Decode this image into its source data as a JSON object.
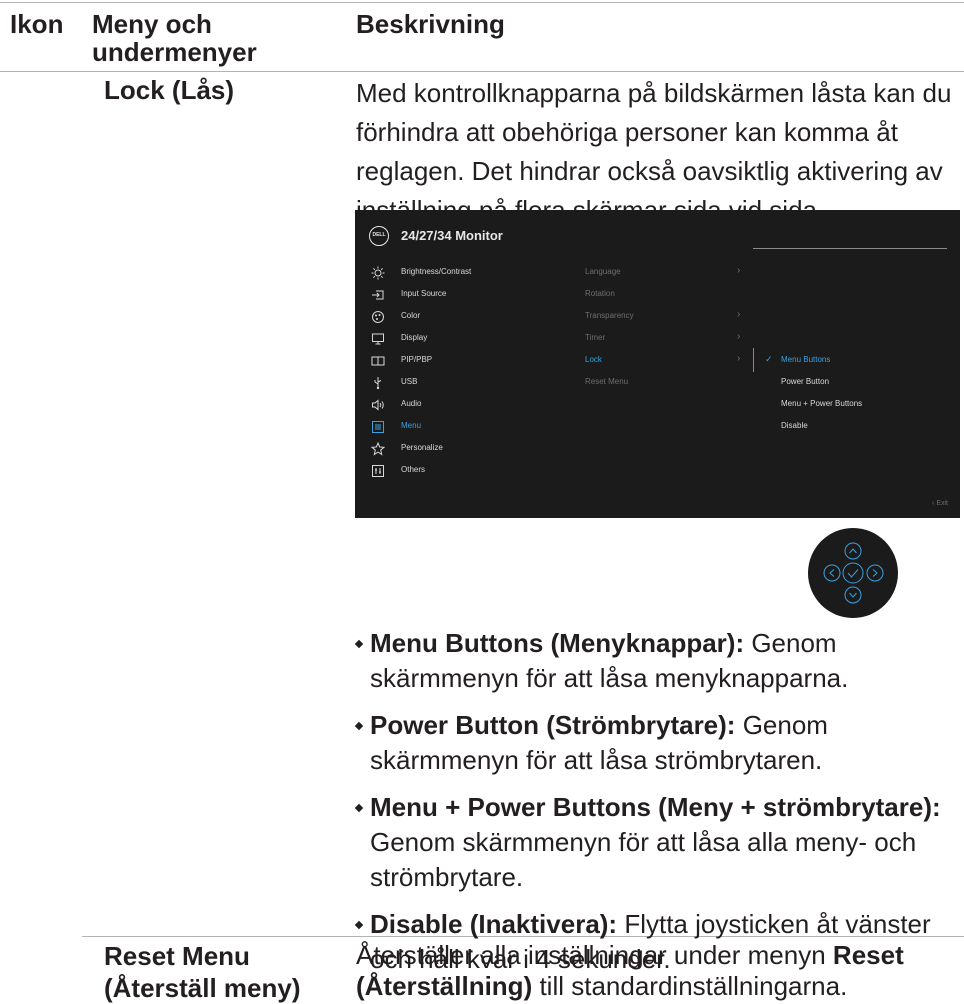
{
  "header": {
    "icon": "Ikon",
    "menu": "Meny och undermenyer",
    "description": "Beskrivning"
  },
  "lock": {
    "name": "Lock (Lås)",
    "intro": "Med kontrollknapparna på bildskärmen låsta kan du förhindra att obehöriga personer kan komma åt reglagen. Det hindrar också oavsiktlig aktivering av inställning på flera skärmar sida vid sida."
  },
  "osd": {
    "title": "24/27/34 Monitor",
    "logo": "DELL",
    "main_menu": [
      "Brightness/Contrast",
      "Input Source",
      "Color",
      "Display",
      "PIP/PBP",
      "USB",
      "Audio",
      "Menu",
      "Personalize",
      "Others"
    ],
    "main_icons": [
      "brightness-icon",
      "input-source-icon",
      "color-icon",
      "display-icon",
      "pip-pbp-icon",
      "usb-icon",
      "audio-icon",
      "menu-icon",
      "personalize-icon",
      "others-icon"
    ],
    "selected_main": "Menu",
    "sub_menu": [
      "Language",
      "Rotation",
      "Transparency",
      "Timer",
      "Lock",
      "Reset Menu"
    ],
    "selected_sub": "Lock",
    "lock_options": [
      "Menu Buttons",
      "Power Button",
      "Menu + Power Buttons",
      "Disable"
    ],
    "selected_option": "Menu Buttons",
    "exit_label": "Exit",
    "accent_color": "#3aa0e0"
  },
  "bullets": [
    {
      "bold": "Menu Buttons (Menyknappar):",
      "text": " Genom skärmmenyn för att låsa menyknapparna."
    },
    {
      "bold": "Power Button (Strömbrytare):",
      "text": " Genom skärmmenyn för att låsa strömbrytaren."
    },
    {
      "bold": "Menu + Power Buttons (Meny + strömbrytare):",
      "text": " Genom skärmmenyn för att låsa alla meny- och strömbrytare."
    },
    {
      "bold": "Disable (Inaktivera):",
      "text": " Flytta joysticken åt vänster och håll kvar i 4 sekunder."
    }
  ],
  "reset": {
    "name": "Reset Menu (Återställ meny)",
    "text_before": "Återställer alla inställningar under menyn ",
    "text_bold": "Reset (Återställning)",
    "text_after": " till standardinställningarna."
  }
}
